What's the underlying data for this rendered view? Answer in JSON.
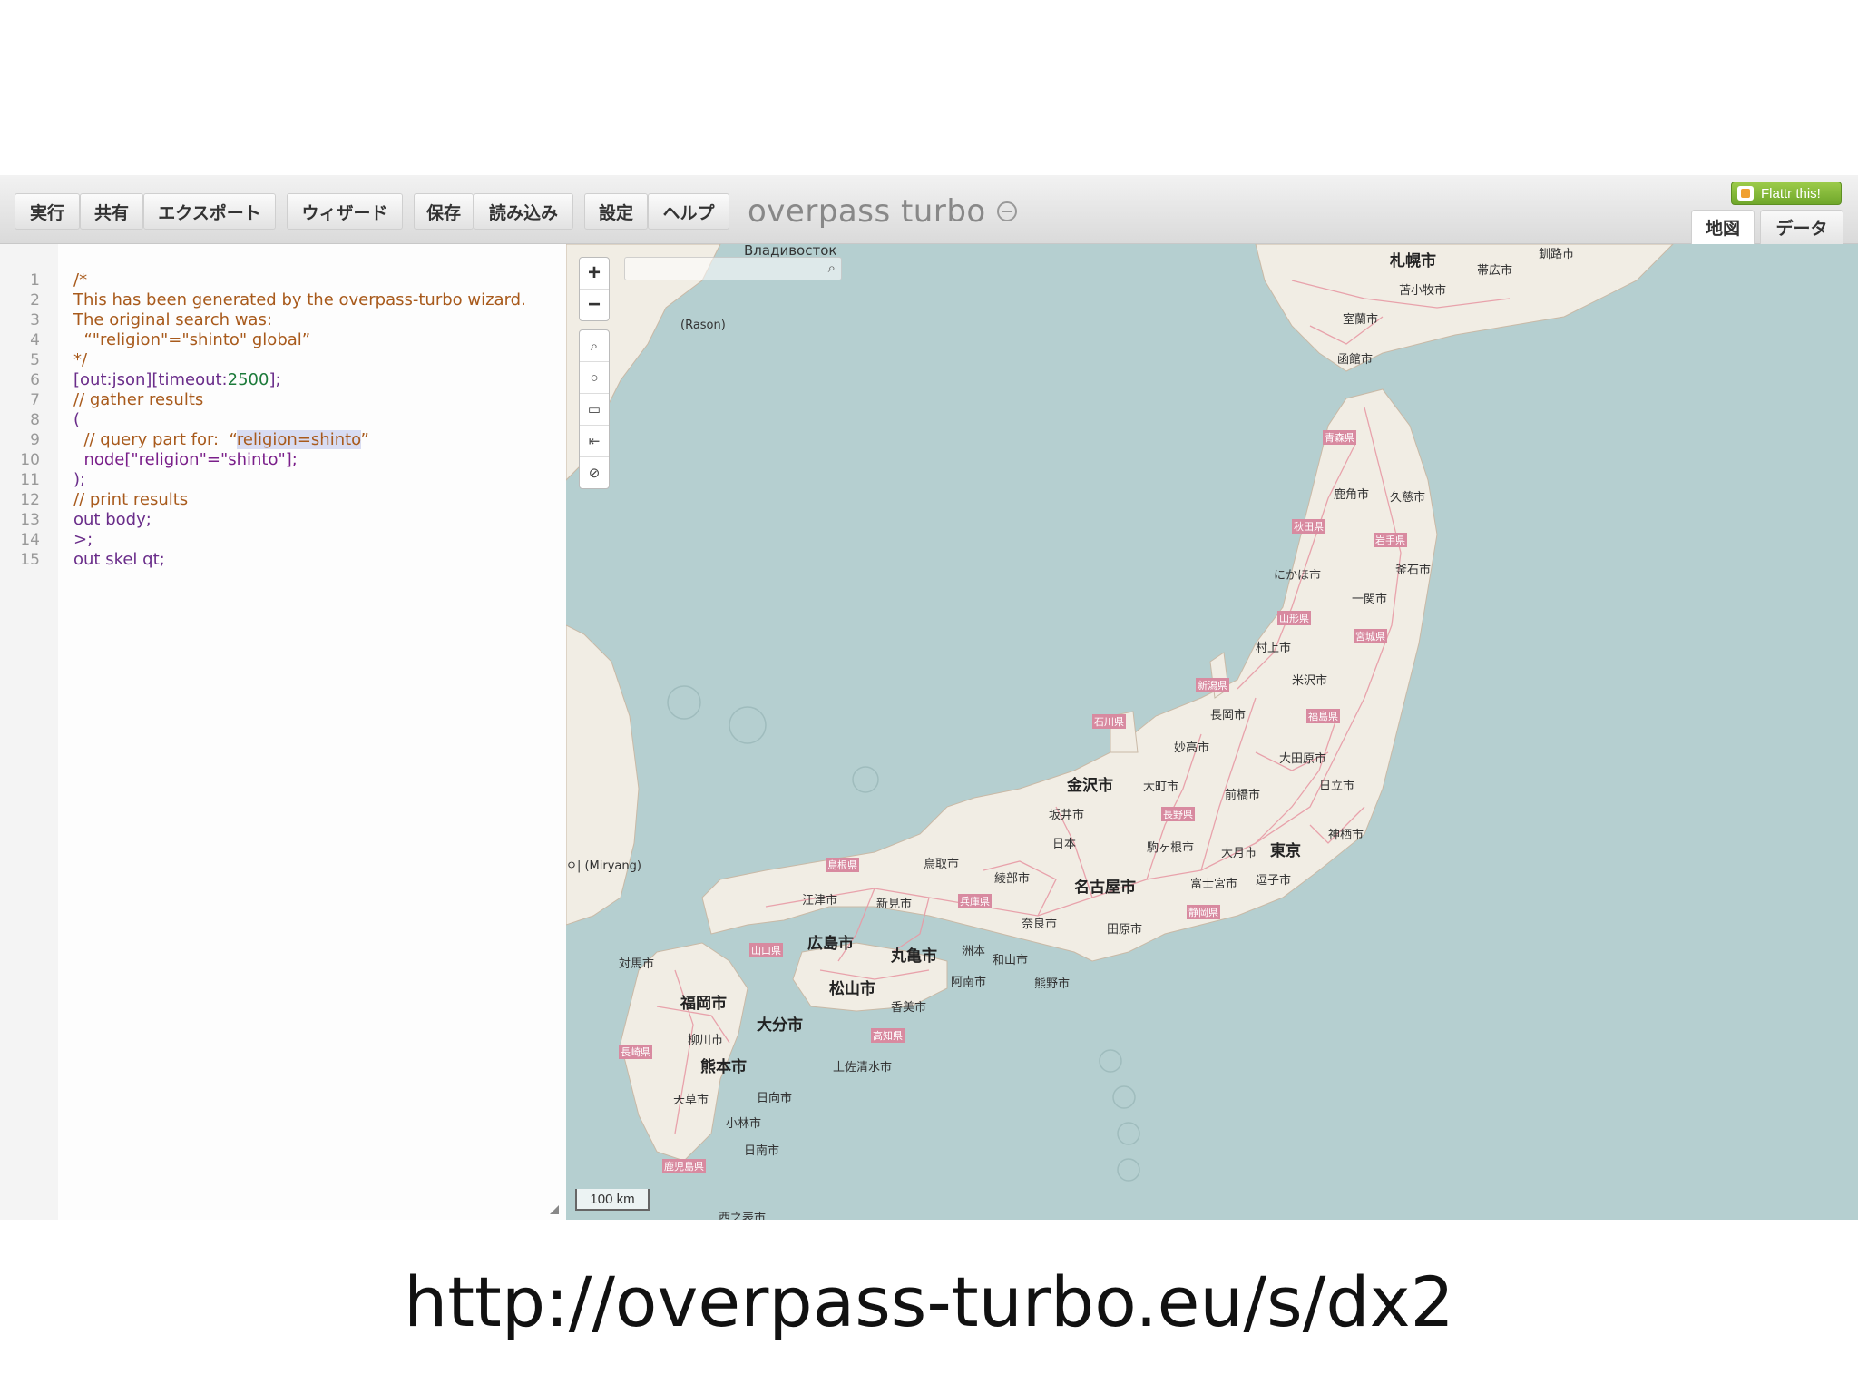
{
  "toolbar": {
    "buttons": [
      "実行",
      "共有",
      "エクスポート",
      "ウィザード",
      "保存",
      "読み込み",
      "設定",
      "ヘルプ"
    ],
    "brand": "overpass turbo",
    "flattr": "Flattr this!",
    "tabs": [
      "地図",
      "データ"
    ]
  },
  "editor": {
    "lines": [
      {
        "n": "1",
        "t": "/*"
      },
      {
        "n": "2",
        "t": "This has been generated by the overpass-turbo wizard."
      },
      {
        "n": "3",
        "t": "The original search was:"
      },
      {
        "n": "4",
        "t": "  “\"religion\"=\"shinto\" global”"
      },
      {
        "n": "5",
        "t": "*/"
      },
      {
        "n": "6",
        "a": "[out:json][timeout:",
        "b": "2500",
        "c": "];"
      },
      {
        "n": "7",
        "t": "// gather results"
      },
      {
        "n": "8",
        "t": "("
      },
      {
        "n": "9",
        "a": "  // query part for:  “",
        "b": "religion=shinto",
        "c": "”"
      },
      {
        "n": "10",
        "t": "  node[\"religion\"=\"shinto\"];"
      },
      {
        "n": "11",
        "t": ");"
      },
      {
        "n": "12",
        "t": "// print results"
      },
      {
        "n": "13",
        "t": "out body;"
      },
      {
        "n": "14",
        "t": ">;"
      },
      {
        "n": "15",
        "t": "out skel qt;"
      }
    ]
  },
  "map": {
    "zoom_in": "+",
    "zoom_out": "−",
    "scale": "100 km",
    "labels": {
      "vladivostok": "Владивосток",
      "rason": "(Rason)",
      "sapporo": "札幌市",
      "tomakomai": "苫小牧市",
      "muroran": "室蘭市",
      "hakodate": "函館市",
      "kushiro": "釧路市",
      "obihiro": "帯広市",
      "aomori": "青森県",
      "kazuno": "鹿角市",
      "kuji": "久慈市",
      "akita": "秋田県",
      "iwate": "岩手県",
      "kamaishi": "釜石市",
      "nikaho": "にかほ市",
      "ichinoseki": "一関市",
      "yamagata": "山形県",
      "miyagi": "宮城県",
      "murakami": "村上市",
      "yonezawa": "米沢市",
      "niigata": "新潟県",
      "fukushima": "福島県",
      "nagaoka": "長岡市",
      "myoko": "妙高市",
      "ishikawa": "石川県",
      "kanazawa": "金沢市",
      "omachi": "大町市",
      "maebashi": "前橋市",
      "tawara": "大田原市",
      "hitachi": "日立市",
      "sakai": "坂井市",
      "nagano": "長野県",
      "komagane": "駒ヶ根市",
      "otsuki": "大月市",
      "tokyo": "東京",
      "kamisu": "神栖市",
      "nihon": "日本",
      "fujinomiya": "富士宮市",
      "shimoda": "逗子市",
      "shizuoka": "静岡県",
      "tahara": "田原市",
      "nagoya": "名古屋市",
      "ayabe": "綾部市",
      "tottori": "鳥取市",
      "shimane": "島根県",
      "gotsu": "江津市",
      "niimi": "新見市",
      "hyogo": "兵庫県",
      "nara": "奈良市",
      "hiroshima": "広島市",
      "yamaguchi": "山口県",
      "marugame": "丸亀市",
      "sumoto": "洲本",
      "okayama": "和山市",
      "matsuyama": "松山市",
      "anan": "阿南市",
      "kumano": "熊野市",
      "tsushima": "対馬市",
      "fukuoka": "福岡市",
      "oita": "大分市",
      "kami": "香美市",
      "kochi": "高知県",
      "yanagawa": "柳川市",
      "nagasaki": "長崎県",
      "kumamoto": "熊本市",
      "tosashimizu": "土佐清水市",
      "amakusa": "天草市",
      "hyuga": "日向市",
      "kobayashi": "小林市",
      "nichinan": "日南市",
      "kagoshima": "鹿児島県",
      "nishinoomote": "西之表市",
      "miryang": "ㅇ| (Miryang)"
    }
  },
  "footer_url": "http://overpass-turbo.eu/s/dx2"
}
